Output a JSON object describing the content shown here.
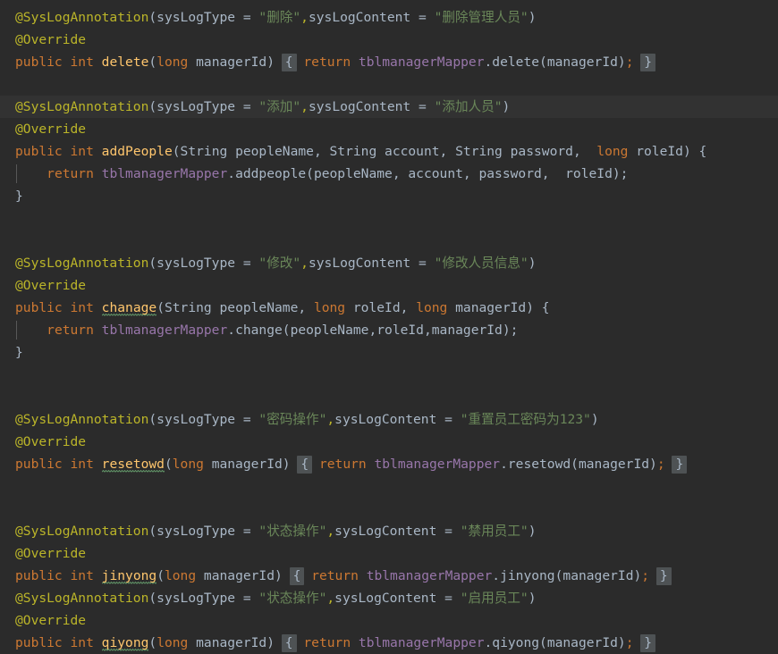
{
  "editor": {
    "theme": "darcula",
    "background": "#2b2b2b",
    "caret_line_background": "#323232",
    "default_text_color": "#a9b7c6",
    "colors": {
      "annotation": "#bbb529",
      "keyword": "#cc7832",
      "string": "#6a8759",
      "method_declaration": "#ffc66d",
      "field": "#9876aa",
      "brace_highlight": "#4e5254",
      "indent_guide": "#585858",
      "typo_squiggle": "#659c6b"
    },
    "caret_line_index": 4
  },
  "code": {
    "lines": [
      {
        "n": 1,
        "tokens": [
          {
            "t": "@SysLogAnnotation",
            "c": "anno"
          },
          {
            "t": "(",
            "c": "punc"
          },
          {
            "t": "sysLogType ",
            "c": "ident"
          },
          {
            "t": "= ",
            "c": "punc"
          },
          {
            "t": "\"删除\"",
            "c": "str"
          },
          {
            "t": ",",
            "c": "anno"
          },
          {
            "t": "sysLogContent ",
            "c": "ident"
          },
          {
            "t": "= ",
            "c": "punc"
          },
          {
            "t": "\"删除管理人员\"",
            "c": "str"
          },
          {
            "t": ")",
            "c": "punc"
          }
        ]
      },
      {
        "n": 2,
        "tokens": [
          {
            "t": "@Override",
            "c": "anno"
          }
        ]
      },
      {
        "n": 3,
        "tokens": [
          {
            "t": "public ",
            "c": "kw"
          },
          {
            "t": "int ",
            "c": "kw"
          },
          {
            "t": "delete",
            "c": "mdecl"
          },
          {
            "t": "(",
            "c": "punc"
          },
          {
            "t": "long ",
            "c": "kw"
          },
          {
            "t": "managerId",
            "c": "ident"
          },
          {
            "t": ")",
            "c": "punc"
          },
          {
            "t": " ",
            "c": "punc"
          },
          {
            "t": "{",
            "c": "brace"
          },
          {
            "t": " ",
            "c": "punc"
          },
          {
            "t": "return ",
            "c": "kw"
          },
          {
            "t": "tblmanagerMapper",
            "c": "field"
          },
          {
            "t": ".",
            "c": "punc"
          },
          {
            "t": "delete",
            "c": "mcall"
          },
          {
            "t": "(",
            "c": "punc"
          },
          {
            "t": "managerId",
            "c": "ident"
          },
          {
            "t": ")",
            "c": "punc"
          },
          {
            "t": ";",
            "c": "kw"
          },
          {
            "t": " ",
            "c": "punc"
          },
          {
            "t": "}",
            "c": "brace"
          }
        ]
      },
      {
        "n": 4,
        "tokens": []
      },
      {
        "n": 5,
        "caret": true,
        "tokens": [
          {
            "t": "@SysLogAnnotation",
            "c": "anno"
          },
          {
            "t": "(",
            "c": "punc"
          },
          {
            "t": "sysLogType ",
            "c": "ident"
          },
          {
            "t": "= ",
            "c": "punc"
          },
          {
            "t": "\"添加\"",
            "c": "str"
          },
          {
            "t": ",",
            "c": "anno"
          },
          {
            "t": "sysLogContent ",
            "c": "ident"
          },
          {
            "t": "= ",
            "c": "punc"
          },
          {
            "t": "\"添加人员\"",
            "c": "str"
          },
          {
            "t": ")",
            "c": "punc"
          }
        ]
      },
      {
        "n": 6,
        "tokens": [
          {
            "t": "@Override",
            "c": "anno"
          }
        ]
      },
      {
        "n": 7,
        "tokens": [
          {
            "t": "public ",
            "c": "kw"
          },
          {
            "t": "int ",
            "c": "kw"
          },
          {
            "t": "addPeople",
            "c": "mdecl"
          },
          {
            "t": "(",
            "c": "punc"
          },
          {
            "t": "String ",
            "c": "ident"
          },
          {
            "t": "peopleName",
            "c": "ident"
          },
          {
            "t": ", ",
            "c": "punc"
          },
          {
            "t": "String ",
            "c": "ident"
          },
          {
            "t": "account",
            "c": "ident"
          },
          {
            "t": ", ",
            "c": "punc"
          },
          {
            "t": "String ",
            "c": "ident"
          },
          {
            "t": "password",
            "c": "ident"
          },
          {
            "t": ",  ",
            "c": "punc"
          },
          {
            "t": "long ",
            "c": "kw"
          },
          {
            "t": "roleId",
            "c": "ident"
          },
          {
            "t": ") {",
            "c": "punc"
          }
        ]
      },
      {
        "n": 8,
        "indent": 1,
        "tokens": [
          {
            "t": "    ",
            "c": "punc"
          },
          {
            "t": "return ",
            "c": "kw"
          },
          {
            "t": "tblmanagerMapper",
            "c": "field"
          },
          {
            "t": ".",
            "c": "punc"
          },
          {
            "t": "addpeople",
            "c": "mcall"
          },
          {
            "t": "(",
            "c": "punc"
          },
          {
            "t": "peopleName",
            "c": "ident"
          },
          {
            "t": ", ",
            "c": "punc"
          },
          {
            "t": "account",
            "c": "ident"
          },
          {
            "t": ", ",
            "c": "punc"
          },
          {
            "t": "password",
            "c": "ident"
          },
          {
            "t": ",  ",
            "c": "punc"
          },
          {
            "t": "roleId",
            "c": "ident"
          },
          {
            "t": ");",
            "c": "punc"
          }
        ]
      },
      {
        "n": 9,
        "tokens": [
          {
            "t": "}",
            "c": "punc"
          }
        ]
      },
      {
        "n": 10,
        "tokens": []
      },
      {
        "n": 11,
        "tokens": []
      },
      {
        "n": 12,
        "tokens": [
          {
            "t": "@SysLogAnnotation",
            "c": "anno"
          },
          {
            "t": "(",
            "c": "punc"
          },
          {
            "t": "sysLogType ",
            "c": "ident"
          },
          {
            "t": "= ",
            "c": "punc"
          },
          {
            "t": "\"修改\"",
            "c": "str"
          },
          {
            "t": ",",
            "c": "anno"
          },
          {
            "t": "sysLogContent ",
            "c": "ident"
          },
          {
            "t": "= ",
            "c": "punc"
          },
          {
            "t": "\"修改人员信息\"",
            "c": "str"
          },
          {
            "t": ")",
            "c": "punc"
          }
        ]
      },
      {
        "n": 13,
        "tokens": [
          {
            "t": "@Override",
            "c": "anno"
          }
        ]
      },
      {
        "n": 14,
        "tokens": [
          {
            "t": "public ",
            "c": "kw"
          },
          {
            "t": "int ",
            "c": "kw"
          },
          {
            "t": "chanage",
            "c": "mdecl",
            "typo": true
          },
          {
            "t": "(",
            "c": "punc"
          },
          {
            "t": "String ",
            "c": "ident"
          },
          {
            "t": "peopleName",
            "c": "ident"
          },
          {
            "t": ", ",
            "c": "punc"
          },
          {
            "t": "long ",
            "c": "kw"
          },
          {
            "t": "roleId",
            "c": "ident"
          },
          {
            "t": ", ",
            "c": "punc"
          },
          {
            "t": "long ",
            "c": "kw"
          },
          {
            "t": "managerId",
            "c": "ident"
          },
          {
            "t": ") {",
            "c": "punc"
          }
        ]
      },
      {
        "n": 15,
        "indent": 1,
        "tokens": [
          {
            "t": "    ",
            "c": "punc"
          },
          {
            "t": "return ",
            "c": "kw"
          },
          {
            "t": "tblmanagerMapper",
            "c": "field"
          },
          {
            "t": ".",
            "c": "punc"
          },
          {
            "t": "change",
            "c": "mcall"
          },
          {
            "t": "(",
            "c": "punc"
          },
          {
            "t": "peopleName",
            "c": "ident"
          },
          {
            "t": ",",
            "c": "punc"
          },
          {
            "t": "roleId",
            "c": "ident"
          },
          {
            "t": ",",
            "c": "punc"
          },
          {
            "t": "managerId",
            "c": "ident"
          },
          {
            "t": ");",
            "c": "punc"
          }
        ]
      },
      {
        "n": 16,
        "tokens": [
          {
            "t": "}",
            "c": "punc"
          }
        ]
      },
      {
        "n": 17,
        "tokens": []
      },
      {
        "n": 18,
        "tokens": []
      },
      {
        "n": 19,
        "tokens": [
          {
            "t": "@SysLogAnnotation",
            "c": "anno"
          },
          {
            "t": "(",
            "c": "punc"
          },
          {
            "t": "sysLogType ",
            "c": "ident"
          },
          {
            "t": "= ",
            "c": "punc"
          },
          {
            "t": "\"密码操作\"",
            "c": "str"
          },
          {
            "t": ",",
            "c": "anno"
          },
          {
            "t": "sysLogContent ",
            "c": "ident"
          },
          {
            "t": "= ",
            "c": "punc"
          },
          {
            "t": "\"重置员工密码为123\"",
            "c": "str"
          },
          {
            "t": ")",
            "c": "punc"
          }
        ]
      },
      {
        "n": 20,
        "tokens": [
          {
            "t": "@Override",
            "c": "anno"
          }
        ]
      },
      {
        "n": 21,
        "tokens": [
          {
            "t": "public ",
            "c": "kw"
          },
          {
            "t": "int ",
            "c": "kw"
          },
          {
            "t": "resetowd",
            "c": "mdecl",
            "typo": true
          },
          {
            "t": "(",
            "c": "punc"
          },
          {
            "t": "long ",
            "c": "kw"
          },
          {
            "t": "managerId",
            "c": "ident"
          },
          {
            "t": ")",
            "c": "punc"
          },
          {
            "t": " ",
            "c": "punc"
          },
          {
            "t": "{",
            "c": "brace"
          },
          {
            "t": " ",
            "c": "punc"
          },
          {
            "t": "return ",
            "c": "kw"
          },
          {
            "t": "tblmanagerMapper",
            "c": "field"
          },
          {
            "t": ".",
            "c": "punc"
          },
          {
            "t": "resetowd",
            "c": "mcall"
          },
          {
            "t": "(",
            "c": "punc"
          },
          {
            "t": "managerId",
            "c": "ident"
          },
          {
            "t": ")",
            "c": "punc"
          },
          {
            "t": ";",
            "c": "kw"
          },
          {
            "t": " ",
            "c": "punc"
          },
          {
            "t": "}",
            "c": "brace"
          }
        ]
      },
      {
        "n": 22,
        "tokens": []
      },
      {
        "n": 23,
        "tokens": []
      },
      {
        "n": 24,
        "tokens": [
          {
            "t": "@SysLogAnnotation",
            "c": "anno"
          },
          {
            "t": "(",
            "c": "punc"
          },
          {
            "t": "sysLogType ",
            "c": "ident"
          },
          {
            "t": "= ",
            "c": "punc"
          },
          {
            "t": "\"状态操作\"",
            "c": "str"
          },
          {
            "t": ",",
            "c": "anno"
          },
          {
            "t": "sysLogContent ",
            "c": "ident"
          },
          {
            "t": "= ",
            "c": "punc"
          },
          {
            "t": "\"禁用员工\"",
            "c": "str"
          },
          {
            "t": ")",
            "c": "punc"
          }
        ]
      },
      {
        "n": 25,
        "tokens": [
          {
            "t": "@Override",
            "c": "anno"
          }
        ]
      },
      {
        "n": 26,
        "tokens": [
          {
            "t": "public ",
            "c": "kw"
          },
          {
            "t": "int ",
            "c": "kw"
          },
          {
            "t": "jinyong",
            "c": "mdecl",
            "typo": true
          },
          {
            "t": "(",
            "c": "punc"
          },
          {
            "t": "long ",
            "c": "kw"
          },
          {
            "t": "managerId",
            "c": "ident"
          },
          {
            "t": ")",
            "c": "punc"
          },
          {
            "t": " ",
            "c": "punc"
          },
          {
            "t": "{",
            "c": "brace"
          },
          {
            "t": " ",
            "c": "punc"
          },
          {
            "t": "return ",
            "c": "kw"
          },
          {
            "t": "tblmanagerMapper",
            "c": "field"
          },
          {
            "t": ".",
            "c": "punc"
          },
          {
            "t": "jinyong",
            "c": "mcall"
          },
          {
            "t": "(",
            "c": "punc"
          },
          {
            "t": "managerId",
            "c": "ident"
          },
          {
            "t": ")",
            "c": "punc"
          },
          {
            "t": ";",
            "c": "kw"
          },
          {
            "t": " ",
            "c": "punc"
          },
          {
            "t": "}",
            "c": "brace"
          }
        ]
      },
      {
        "n": 27,
        "tokens": [
          {
            "t": "@SysLogAnnotation",
            "c": "anno"
          },
          {
            "t": "(",
            "c": "punc"
          },
          {
            "t": "sysLogType ",
            "c": "ident"
          },
          {
            "t": "= ",
            "c": "punc"
          },
          {
            "t": "\"状态操作\"",
            "c": "str"
          },
          {
            "t": ",",
            "c": "anno"
          },
          {
            "t": "sysLogContent ",
            "c": "ident"
          },
          {
            "t": "= ",
            "c": "punc"
          },
          {
            "t": "\"启用员工\"",
            "c": "str"
          },
          {
            "t": ")",
            "c": "punc"
          }
        ]
      },
      {
        "n": 28,
        "tokens": [
          {
            "t": "@Override",
            "c": "anno"
          }
        ]
      },
      {
        "n": 29,
        "tokens": [
          {
            "t": "public ",
            "c": "kw"
          },
          {
            "t": "int ",
            "c": "kw"
          },
          {
            "t": "qiyong",
            "c": "mdecl",
            "typo": true
          },
          {
            "t": "(",
            "c": "punc"
          },
          {
            "t": "long ",
            "c": "kw"
          },
          {
            "t": "managerId",
            "c": "ident"
          },
          {
            "t": ")",
            "c": "punc"
          },
          {
            "t": " ",
            "c": "punc"
          },
          {
            "t": "{",
            "c": "brace"
          },
          {
            "t": " ",
            "c": "punc"
          },
          {
            "t": "return ",
            "c": "kw"
          },
          {
            "t": "tblmanagerMapper",
            "c": "field"
          },
          {
            "t": ".",
            "c": "punc"
          },
          {
            "t": "qiyong",
            "c": "mcall"
          },
          {
            "t": "(",
            "c": "punc"
          },
          {
            "t": "managerId",
            "c": "ident"
          },
          {
            "t": ")",
            "c": "punc"
          },
          {
            "t": ";",
            "c": "kw"
          },
          {
            "t": " ",
            "c": "punc"
          },
          {
            "t": "}",
            "c": "brace"
          }
        ]
      }
    ]
  }
}
